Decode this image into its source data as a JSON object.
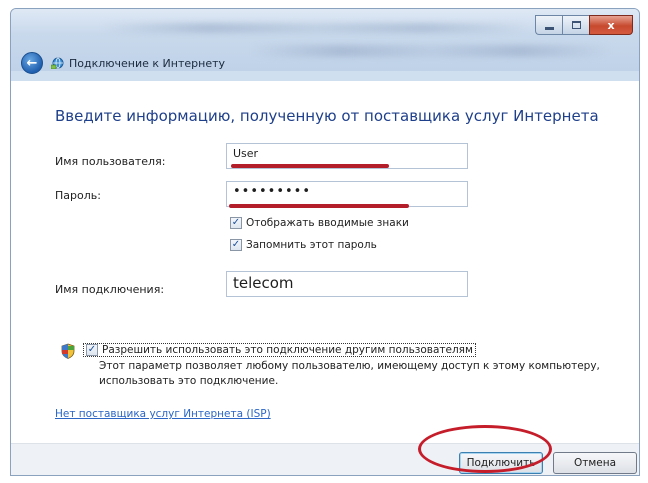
{
  "window": {
    "title": "Подключение к Интернету",
    "minimize_glyph": "",
    "close_glyph": "x",
    "back_glyph": "←"
  },
  "main": {
    "heading": "Введите информацию, полученную от поставщика услуг Интернета",
    "username_label": "Имя пользователя:",
    "username_value": "User",
    "password_label": "Пароль:",
    "password_value": "•••••••••",
    "show_chars_label": "Отображать вводимые знаки",
    "show_chars_checked": true,
    "remember_label": "Запомнить этот пароль",
    "remember_checked": true,
    "connection_name_label": "Имя подключения:",
    "connection_name_value": "telecom",
    "allow_others_label": "Разрешить использовать это подключение другим пользователям",
    "allow_others_checked": true,
    "allow_others_description": "Этот параметр позволяет любому пользователю, имеющему доступ к этому компьютеру, использовать это подключение.",
    "no_isp_link": "Нет поставщика услуг Интернета (ISP)",
    "check_glyph": "✓"
  },
  "footer": {
    "connect_button": "Подключить",
    "cancel_button": "Отмена"
  },
  "colors": {
    "heading": "#1e3f8a",
    "annotation_red": "#b41e2a",
    "link": "#2b66c4"
  },
  "icons": {
    "back": "back-arrow-icon",
    "network": "network-globe-icon",
    "shield": "uac-shield-icon"
  }
}
